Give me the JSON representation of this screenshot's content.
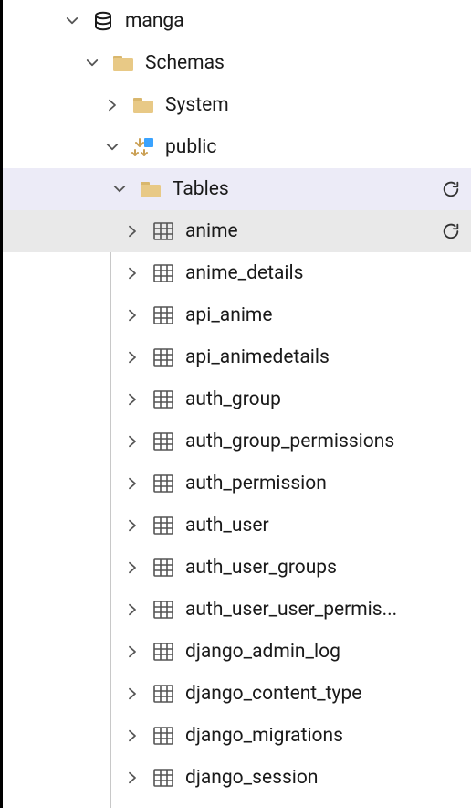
{
  "tree": {
    "database": {
      "label": "manga",
      "expanded": true
    },
    "schemas": {
      "label": "Schemas",
      "expanded": true
    },
    "system": {
      "label": "System",
      "expanded": false
    },
    "public": {
      "label": "public",
      "expanded": true
    },
    "tables": {
      "label": "Tables",
      "expanded": true,
      "selected": true,
      "refresh": true
    },
    "items": [
      {
        "label": "anime",
        "selected": true,
        "refresh": true
      },
      {
        "label": "anime_details"
      },
      {
        "label": "api_anime"
      },
      {
        "label": "api_animedetails"
      },
      {
        "label": "auth_group"
      },
      {
        "label": "auth_group_permissions"
      },
      {
        "label": "auth_permission"
      },
      {
        "label": "auth_user"
      },
      {
        "label": "auth_user_groups"
      },
      {
        "label": "auth_user_user_permis..."
      },
      {
        "label": "django_admin_log"
      },
      {
        "label": "django_content_type"
      },
      {
        "label": "django_migrations"
      },
      {
        "label": "django_session"
      }
    ]
  }
}
